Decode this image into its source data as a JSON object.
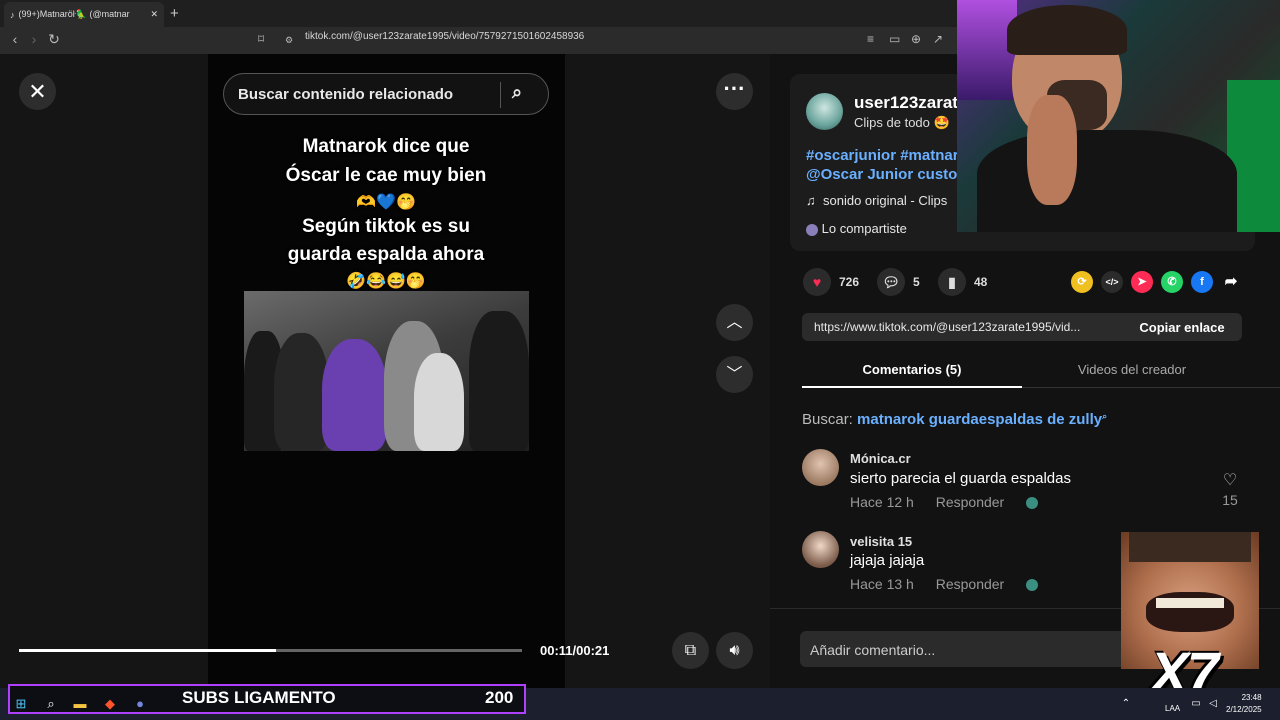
{
  "browser": {
    "tab_title": "(99+)Matnaröŀ🦜 (@matnar",
    "url": "tiktok.com/@user123zarate1995/video/7579271501602458936"
  },
  "video": {
    "search_placeholder": "Buscar contenido relacionado",
    "caption_lines": [
      "Matnarok dice que",
      "Óscar le cae muy bien",
      "🫶💙🤭",
      "Según tiktok es su",
      "guarda espalda ahora",
      "🤣😂😅🤭"
    ],
    "time": "00:11/00:21",
    "progress": 0.51
  },
  "creator": {
    "username": "user123zarat",
    "subtitle": "Clips de todo 🤩",
    "tags_line1": "#oscarjunior #matnar",
    "tags_line2": "@Oscar Junior custod",
    "sound": "sonido original - Clips",
    "shared": "Lo compartiste"
  },
  "stats": {
    "likes": "726",
    "comments": "5",
    "saves": "48"
  },
  "share": {
    "link": "https://www.tiktok.com/@user123zarate1995/vid...",
    "copy_label": "Copiar enlace"
  },
  "tabs": {
    "comments": "Comentarios (5)",
    "videos": "Videos del creador"
  },
  "search_suggest": {
    "label": "Buscar:",
    "query": "matnarok guardaespaldas de zully"
  },
  "comments": [
    {
      "name": "Mónica.cr",
      "text": "sierto parecia el guarda espaldas",
      "time": "Hace 12 h",
      "reply": "Responder",
      "likes": "15"
    },
    {
      "name": "velisita 15",
      "text": "jajaja jajaja",
      "time": "Hace 13 h",
      "reply": "Responder",
      "likes": ""
    }
  ],
  "add_comment_placeholder": "Añadir comentario...",
  "overlay": {
    "multiplier": "X7"
  },
  "stream_bar": {
    "label": "SUBS LIGAMENTO",
    "count": "200"
  },
  "system": {
    "lang": "LAA",
    "time": "23:48",
    "date": "2/12/2025"
  }
}
